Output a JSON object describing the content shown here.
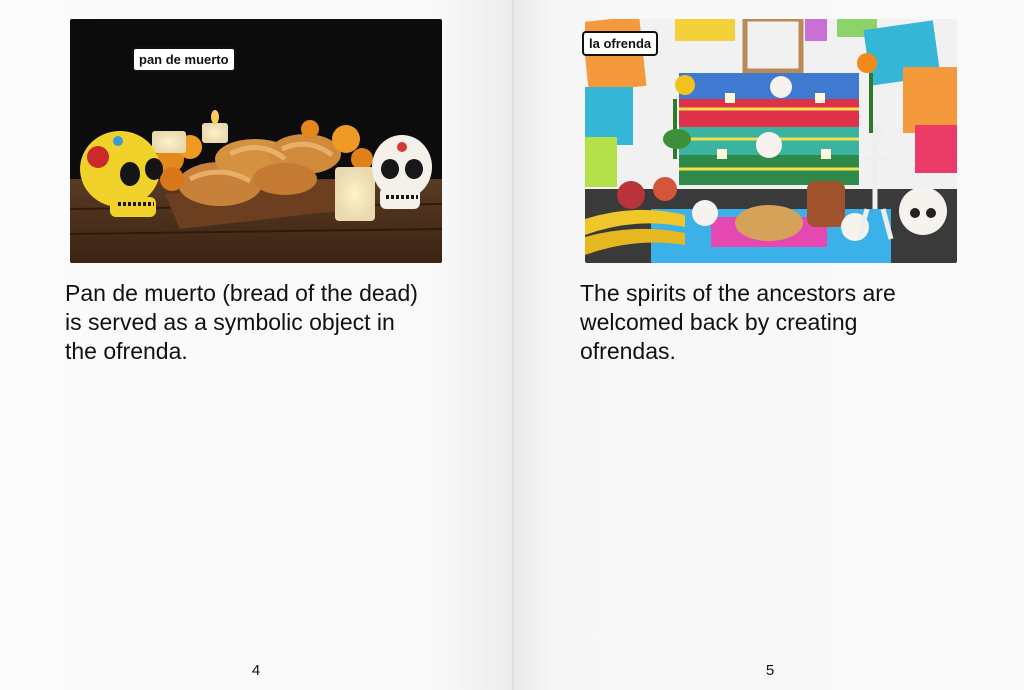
{
  "pages": [
    {
      "image_label": "pan de muerto",
      "caption": "Pan de muerto (bread of the dead)\nis served as a symbolic object in\nthe ofrenda.",
      "page_number": "4"
    },
    {
      "image_label": "la ofrenda",
      "caption": "The spirits of the ancestors are\nwelcomed back by creating\nofrendas.",
      "page_number": "5"
    }
  ]
}
